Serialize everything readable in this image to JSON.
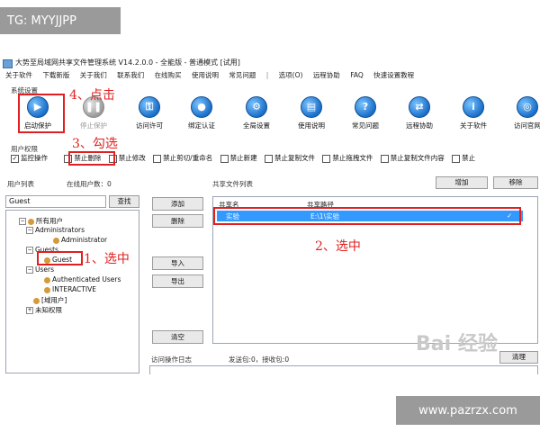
{
  "tg_label": "TG: MYYJJPP",
  "window_title": "大势至局域网共享文件管理系统 V14.2.0.0 - 全能版 - 普通模式 [试用]",
  "menu": [
    "关于软件",
    "下载新版",
    "关于我们",
    "联系我们",
    "在线购买",
    "使用说明",
    "常见问题",
    "选项(O)",
    "远程协助",
    "FAQ",
    "快速设置教程"
  ],
  "system_settings_label": "系统设置",
  "toolbar": [
    {
      "label": "启动保护",
      "icon": "play-icon"
    },
    {
      "label": "停止保护",
      "icon": "pause-icon"
    },
    {
      "label": "访问许可",
      "icon": "key-icon"
    },
    {
      "label": "绑定认证",
      "icon": "lock-icon"
    },
    {
      "label": "全局设置",
      "icon": "gear-icon"
    },
    {
      "label": "使用说明",
      "icon": "help-icon"
    },
    {
      "label": "常见问题",
      "icon": "question-icon"
    },
    {
      "label": "远程协助",
      "icon": "remote-icon"
    },
    {
      "label": "关于软件",
      "icon": "info-icon"
    },
    {
      "label": "访问官网",
      "icon": "globe-icon"
    }
  ],
  "user_permissions_label": "用户权限",
  "permissions": [
    {
      "label": "监控操作",
      "checked": true
    },
    {
      "label": "禁止删除",
      "checked": false
    },
    {
      "label": "禁止修改",
      "checked": false
    },
    {
      "label": "禁止剪切/重命名",
      "checked": false
    },
    {
      "label": "禁止新建",
      "checked": false
    },
    {
      "label": "禁止复制文件",
      "checked": false
    },
    {
      "label": "禁止拖拽文件",
      "checked": false
    },
    {
      "label": "禁止复制文件内容",
      "checked": false
    },
    {
      "label": "禁止"
    }
  ],
  "user_list_label": "用户列表",
  "online_users_label": "在线用户数：0",
  "search_value": "Guest",
  "search_button": "查找",
  "tree": {
    "all_users": "所有用户",
    "administrators": "Administrators",
    "administrator": "Administrator",
    "guests": "Guests",
    "guest": "Guest",
    "users": "Users",
    "authenticated_users": "Authenticated Users",
    "interactive": "INTERACTIVE",
    "domain_users": "[域用户]",
    "unknown_perm": "未知权限"
  },
  "mid_buttons": {
    "add": "添加",
    "delete": "删除",
    "import": "导入",
    "export": "导出",
    "clear": "清空"
  },
  "shared_files_label": "共享文件列表",
  "shared_buttons": {
    "add": "增加",
    "remove": "移除"
  },
  "shared_columns": [
    "共享名",
    "共享路径"
  ],
  "shared_rows": [
    {
      "name": "实验",
      "path": "E:\\1\\实验",
      "check": "✓"
    }
  ],
  "log_label": "访问操作日志",
  "log_stats": "发送包:0，接收包:0",
  "log_clear": "清理",
  "annotations": {
    "step1": "1、选中",
    "step2": "2、选中",
    "step3": "3、勾选",
    "step4": "4、点击"
  },
  "baidu_text": "Bai 经验",
  "website": "www.pazrzx.com",
  "colors": {
    "annotation_red": "#e02020",
    "selection_blue": "#3399ff",
    "icon_blue": "#1a6fc9"
  }
}
